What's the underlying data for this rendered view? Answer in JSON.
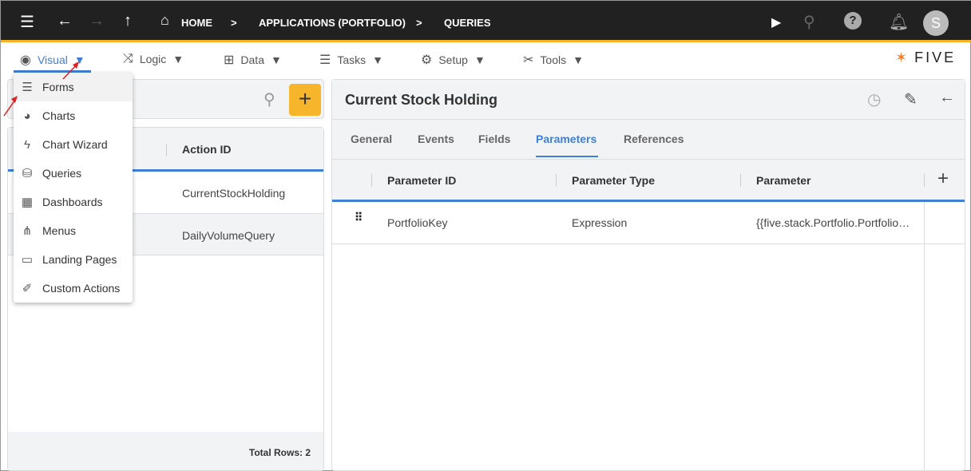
{
  "topbar": {
    "breadcrumbs": [
      "HOME",
      "APPLICATIONS (PORTFOLIO)",
      "QUERIES"
    ],
    "avatar": "S"
  },
  "menu": [
    {
      "label": "Visual",
      "icon": "eye-icon"
    },
    {
      "label": "Logic",
      "icon": "logic-icon"
    },
    {
      "label": "Data",
      "icon": "table-icon"
    },
    {
      "label": "Tasks",
      "icon": "tasks-icon"
    },
    {
      "label": "Setup",
      "icon": "gear-icon"
    },
    {
      "label": "Tools",
      "icon": "tools-icon"
    }
  ],
  "logo": "FIVE",
  "dropdown": [
    "Forms",
    "Charts",
    "Chart Wizard",
    "Queries",
    "Dashboards",
    "Menus",
    "Landing Pages",
    "Custom Actions"
  ],
  "left": {
    "column": "Action ID",
    "rows": [
      "CurrentStockHolding",
      "DailyVolumeQuery"
    ],
    "footer": "Total Rows: 2"
  },
  "right": {
    "title": "Current Stock Holding",
    "tabs": [
      "General",
      "Events",
      "Fields",
      "Parameters",
      "References"
    ],
    "active_tab": "Parameters",
    "columns": [
      "Parameter ID",
      "Parameter Type",
      "Parameter"
    ],
    "rows": [
      [
        "PortfolioKey",
        "Expression",
        "{{five.stack.Portfolio.Portfolio…"
      ]
    ]
  },
  "colors": {
    "accent": "#3f7fd6",
    "topbar": "#212121",
    "highlight": "#f4b223"
  }
}
